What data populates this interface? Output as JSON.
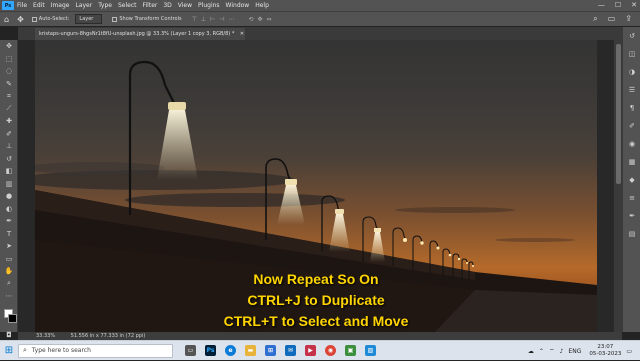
{
  "app": {
    "logo": "Ps"
  },
  "menu": [
    "File",
    "Edit",
    "Image",
    "Layer",
    "Type",
    "Select",
    "Filter",
    "3D",
    "View",
    "Plugins",
    "Window",
    "Help"
  ],
  "window_controls": {
    "minimize": "—",
    "maximize": "☐",
    "close": "✕"
  },
  "options_bar": {
    "auto_select_label": "Auto-Select:",
    "auto_select_target": "Layer",
    "show_transform_label": "Show Transform Controls"
  },
  "document_tab": {
    "title": "kristaps-ungurs-8hgsNr1t8fU-unsplash.jpg @ 33.3% (Layer 1 copy 3, RGB/8) *",
    "close": "✕"
  },
  "overlay_text": [
    "Now Repeat So On",
    "CTRL+J to Duplicate",
    "CTRL+T to Select and Move"
  ],
  "status_bar": {
    "zoom": "33.33%",
    "doc_size": "51.556 in x 77.333 in (72 ppi)"
  },
  "taskbar": {
    "search_placeholder": "Type here to search",
    "tray_lang": "ENG",
    "time": "23:07",
    "date": "05-03-2023"
  },
  "colors": {
    "overlay_text": "#ffd500",
    "ps_blue": "#31a8ff",
    "ui_panel": "#535353"
  },
  "icons": {
    "toolbar": [
      "move-icon",
      "marquee-icon",
      "lasso-icon",
      "quick-select-icon",
      "crop-icon",
      "eyedropper-icon",
      "healing-brush-icon",
      "brush-icon",
      "clone-stamp-icon",
      "history-brush-icon",
      "eraser-icon",
      "gradient-icon",
      "blur-icon",
      "dodge-icon",
      "pen-icon",
      "type-icon",
      "path-select-icon",
      "rectangle-icon",
      "hand-icon",
      "zoom-icon"
    ],
    "panel": [
      "history-icon",
      "layers-icon",
      "adjustments-icon",
      "properties-icon",
      "paragraph-icon",
      "brush-settings-icon",
      "color-icon",
      "swatches-icon",
      "styles-icon",
      "channels-icon",
      "paths-icon",
      "libraries-icon"
    ]
  }
}
